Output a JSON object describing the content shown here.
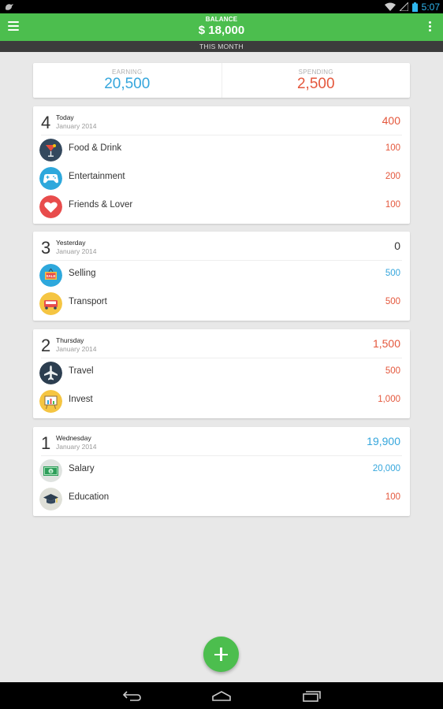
{
  "statusbar": {
    "time": "5:07"
  },
  "appbar": {
    "title": "BALANCE",
    "balance": "$ 18,000",
    "period": "THIS MONTH"
  },
  "summary": {
    "earning_label": "EARNING",
    "earning_value": "20,500",
    "spending_label": "SPENDING",
    "spending_value": "2,500"
  },
  "colors": {
    "accent": "#4cbe4e",
    "earning": "#35a6dc",
    "spending": "#e4573c"
  },
  "days": [
    {
      "num": "4",
      "name": "Today",
      "month": "January 2014",
      "total": "400",
      "total_type": "spend",
      "items": [
        {
          "icon": "cocktail-icon",
          "name": "Food & Drink",
          "amount": "100",
          "type": "spend"
        },
        {
          "icon": "gamepad-icon",
          "name": "Entertainment",
          "amount": "200",
          "type": "spend"
        },
        {
          "icon": "heart-icon",
          "name": "Friends & Lover",
          "amount": "100",
          "type": "spend"
        }
      ]
    },
    {
      "num": "3",
      "name": "Yesterday",
      "month": "January 2014",
      "total": "0",
      "total_type": "neutral",
      "items": [
        {
          "icon": "sale-tag-icon",
          "name": "Selling",
          "amount": "500",
          "type": "earn"
        },
        {
          "icon": "car-icon",
          "name": "Transport",
          "amount": "500",
          "type": "spend"
        }
      ]
    },
    {
      "num": "2",
      "name": "Thursday",
      "month": "January 2014",
      "total": "1,500",
      "total_type": "spend",
      "items": [
        {
          "icon": "airplane-icon",
          "name": "Travel",
          "amount": "500",
          "type": "spend"
        },
        {
          "icon": "chart-board-icon",
          "name": "Invest",
          "amount": "1,000",
          "type": "spend"
        }
      ]
    },
    {
      "num": "1",
      "name": "Wednesday",
      "month": "January 2014",
      "total": "19,900",
      "total_type": "earn",
      "items": [
        {
          "icon": "money-icon",
          "name": "Salary",
          "amount": "20,000",
          "type": "earn"
        },
        {
          "icon": "graduation-cap-icon",
          "name": "Education",
          "amount": "100",
          "type": "spend"
        }
      ]
    }
  ]
}
